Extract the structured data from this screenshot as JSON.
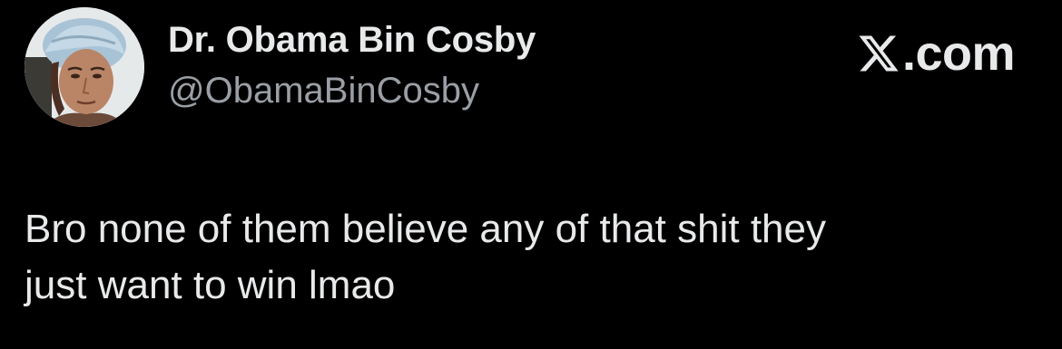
{
  "author": {
    "name": "Dr. Obama Bin Cosby",
    "handle": "@ObamaBinCosby",
    "avatar_icon": "profile-photo-avatar"
  },
  "brand": {
    "icon": "x-logo-icon",
    "suffix": ".com",
    "color": "#e7e9ea"
  },
  "tweet": {
    "text": "Bro none of them believe any of that shit they\njust want to win lmao"
  },
  "colors": {
    "background": "#000000",
    "primary_text": "#e7e9ea",
    "secondary_text": "#9a9fa5"
  }
}
